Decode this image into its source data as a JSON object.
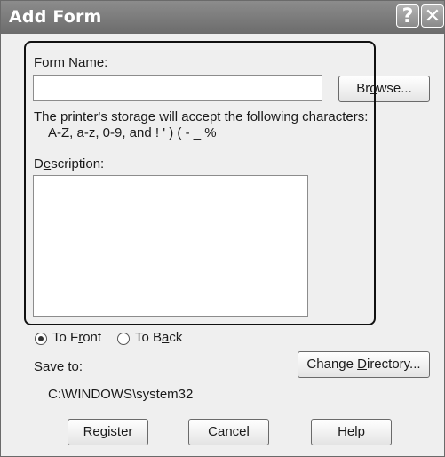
{
  "window": {
    "title": "Add Form",
    "help_glyph": "?",
    "close_glyph": "✕"
  },
  "form_name": {
    "label_prefix": "",
    "label_mnemonic": "F",
    "label_rest": "orm Name:",
    "value": ""
  },
  "browse_button": {
    "pre": "Br",
    "mnemonic": "o",
    "post": "wse..."
  },
  "hint": {
    "line1": "The printer's storage will accept the following characters:",
    "line2": "A-Z, a-z, 0-9, and ! ' ) ( - _ %"
  },
  "description": {
    "label_pre": "D",
    "label_mnemonic": "e",
    "label_rest": "scription:",
    "value": ""
  },
  "position": {
    "to_front": {
      "pre": "To F",
      "mnemonic": "r",
      "post": "ont",
      "selected": true
    },
    "to_back": {
      "pre": "To B",
      "mnemonic": "a",
      "post": "ck",
      "selected": false
    }
  },
  "save_to": {
    "label": "Save to:",
    "path": "C:\\WINDOWS\\system32"
  },
  "change_directory_button": {
    "pre": "Change ",
    "mnemonic": "D",
    "post": "irectory..."
  },
  "buttons": {
    "register": "Register",
    "cancel": "Cancel",
    "help_mnemonic": "H",
    "help_rest": "elp"
  },
  "colors": {
    "titlebar": "#7a7a7a",
    "dialog_bg": "#efefef",
    "highlight_border": "#111111"
  }
}
